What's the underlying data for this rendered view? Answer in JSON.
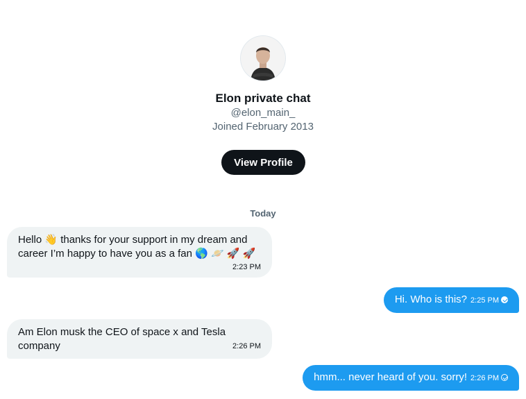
{
  "profile": {
    "name": "Elon private chat",
    "handle": "@elon_main_",
    "joined": "Joined February 2013",
    "view_profile_label": "View Profile"
  },
  "date_separator": "Today",
  "messages": [
    {
      "direction": "incoming",
      "text_line1": "Hello 👋 thanks for your support in my dream and",
      "text_line2": "career I’m happy to have you as a fan 🌎 🪐 🚀 🚀",
      "time": "2:23 PM"
    },
    {
      "direction": "outgoing",
      "text": "Hi. Who is this?",
      "time": "2:25 PM",
      "status_icon": "read-check-icon"
    },
    {
      "direction": "incoming",
      "text_line1": "Am Elon musk the CEO of space x and Tesla",
      "text_line2": "company",
      "time": "2:26 PM"
    },
    {
      "direction": "outgoing",
      "text": "hmm... never heard of you. sorry!",
      "time": "2:26 PM",
      "status_icon": "sent-check-icon"
    }
  ],
  "colors": {
    "outgoing_bubble": "#1d9bf0",
    "incoming_bubble": "#eff3f4",
    "primary_button": "#0f1419",
    "secondary_text": "#536471"
  }
}
